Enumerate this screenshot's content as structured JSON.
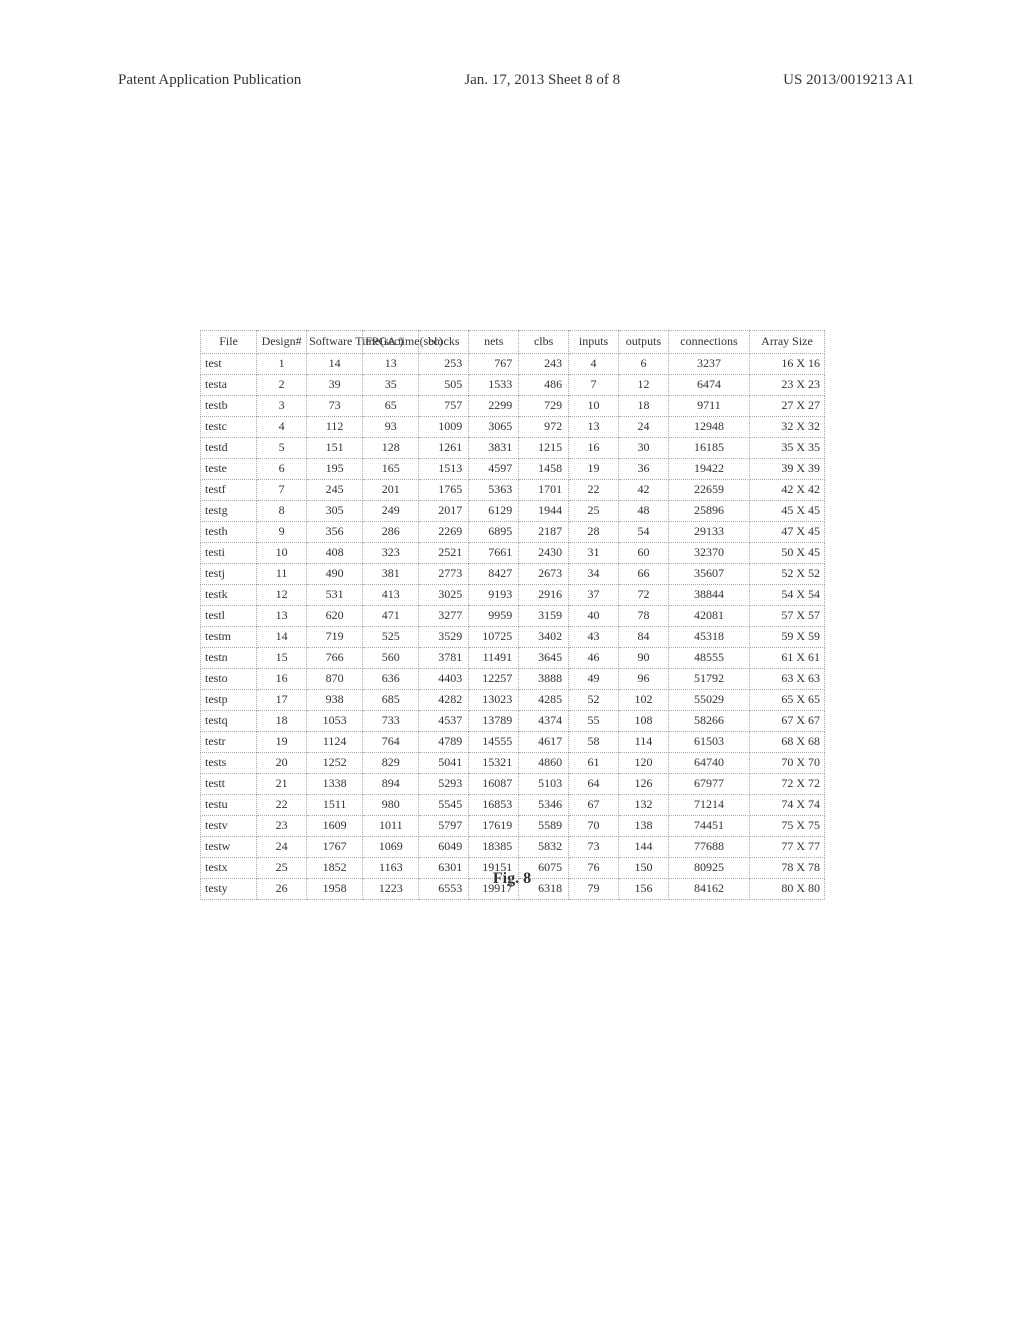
{
  "header": {
    "left": "Patent Application Publication",
    "center": "Jan. 17, 2013  Sheet 8 of 8",
    "right": "US 2013/0019213 A1"
  },
  "table": {
    "columns": [
      "File",
      "Design#",
      "Software Time(sec)",
      "FPGA time(sec)",
      "blocks",
      "nets",
      "clbs",
      "inputs",
      "outputs",
      "connections",
      "Array Size"
    ],
    "rows": [
      {
        "file": "test",
        "design": "1",
        "sw": "14",
        "fpga": "13",
        "blocks": "253",
        "nets": "767",
        "clbs": "243",
        "inputs": "4",
        "outputs": "6",
        "conn": "3237",
        "array": "16 X 16"
      },
      {
        "file": "testa",
        "design": "2",
        "sw": "39",
        "fpga": "35",
        "blocks": "505",
        "nets": "1533",
        "clbs": "486",
        "inputs": "7",
        "outputs": "12",
        "conn": "6474",
        "array": "23 X 23"
      },
      {
        "file": "testb",
        "design": "3",
        "sw": "73",
        "fpga": "65",
        "blocks": "757",
        "nets": "2299",
        "clbs": "729",
        "inputs": "10",
        "outputs": "18",
        "conn": "9711",
        "array": "27 X 27"
      },
      {
        "file": "testc",
        "design": "4",
        "sw": "112",
        "fpga": "93",
        "blocks": "1009",
        "nets": "3065",
        "clbs": "972",
        "inputs": "13",
        "outputs": "24",
        "conn": "12948",
        "array": "32 X 32"
      },
      {
        "file": "testd",
        "design": "5",
        "sw": "151",
        "fpga": "128",
        "blocks": "1261",
        "nets": "3831",
        "clbs": "1215",
        "inputs": "16",
        "outputs": "30",
        "conn": "16185",
        "array": "35 X 35"
      },
      {
        "file": "teste",
        "design": "6",
        "sw": "195",
        "fpga": "165",
        "blocks": "1513",
        "nets": "4597",
        "clbs": "1458",
        "inputs": "19",
        "outputs": "36",
        "conn": "19422",
        "array": "39 X 39"
      },
      {
        "file": "testf",
        "design": "7",
        "sw": "245",
        "fpga": "201",
        "blocks": "1765",
        "nets": "5363",
        "clbs": "1701",
        "inputs": "22",
        "outputs": "42",
        "conn": "22659",
        "array": "42 X 42"
      },
      {
        "file": "testg",
        "design": "8",
        "sw": "305",
        "fpga": "249",
        "blocks": "2017",
        "nets": "6129",
        "clbs": "1944",
        "inputs": "25",
        "outputs": "48",
        "conn": "25896",
        "array": "45 X 45"
      },
      {
        "file": "testh",
        "design": "9",
        "sw": "356",
        "fpga": "286",
        "blocks": "2269",
        "nets": "6895",
        "clbs": "2187",
        "inputs": "28",
        "outputs": "54",
        "conn": "29133",
        "array": "47 X 45"
      },
      {
        "file": "testi",
        "design": "10",
        "sw": "408",
        "fpga": "323",
        "blocks": "2521",
        "nets": "7661",
        "clbs": "2430",
        "inputs": "31",
        "outputs": "60",
        "conn": "32370",
        "array": "50 X 45"
      },
      {
        "file": "testj",
        "design": "11",
        "sw": "490",
        "fpga": "381",
        "blocks": "2773",
        "nets": "8427",
        "clbs": "2673",
        "inputs": "34",
        "outputs": "66",
        "conn": "35607",
        "array": "52 X 52"
      },
      {
        "file": "testk",
        "design": "12",
        "sw": "531",
        "fpga": "413",
        "blocks": "3025",
        "nets": "9193",
        "clbs": "2916",
        "inputs": "37",
        "outputs": "72",
        "conn": "38844",
        "array": "54 X 54"
      },
      {
        "file": "testl",
        "design": "13",
        "sw": "620",
        "fpga": "471",
        "blocks": "3277",
        "nets": "9959",
        "clbs": "3159",
        "inputs": "40",
        "outputs": "78",
        "conn": "42081",
        "array": "57 X 57"
      },
      {
        "file": "testm",
        "design": "14",
        "sw": "719",
        "fpga": "525",
        "blocks": "3529",
        "nets": "10725",
        "clbs": "3402",
        "inputs": "43",
        "outputs": "84",
        "conn": "45318",
        "array": "59 X 59"
      },
      {
        "file": "testn",
        "design": "15",
        "sw": "766",
        "fpga": "560",
        "blocks": "3781",
        "nets": "11491",
        "clbs": "3645",
        "inputs": "46",
        "outputs": "90",
        "conn": "48555",
        "array": "61 X 61"
      },
      {
        "file": "testo",
        "design": "16",
        "sw": "870",
        "fpga": "636",
        "blocks": "4403",
        "nets": "12257",
        "clbs": "3888",
        "inputs": "49",
        "outputs": "96",
        "conn": "51792",
        "array": "63 X 63"
      },
      {
        "file": "testp",
        "design": "17",
        "sw": "938",
        "fpga": "685",
        "blocks": "4282",
        "nets": "13023",
        "clbs": "4285",
        "inputs": "52",
        "outputs": "102",
        "conn": "55029",
        "array": "65 X 65"
      },
      {
        "file": "testq",
        "design": "18",
        "sw": "1053",
        "fpga": "733",
        "blocks": "4537",
        "nets": "13789",
        "clbs": "4374",
        "inputs": "55",
        "outputs": "108",
        "conn": "58266",
        "array": "67 X 67"
      },
      {
        "file": "testr",
        "design": "19",
        "sw": "1124",
        "fpga": "764",
        "blocks": "4789",
        "nets": "14555",
        "clbs": "4617",
        "inputs": "58",
        "outputs": "114",
        "conn": "61503",
        "array": "68 X 68"
      },
      {
        "file": "tests",
        "design": "20",
        "sw": "1252",
        "fpga": "829",
        "blocks": "5041",
        "nets": "15321",
        "clbs": "4860",
        "inputs": "61",
        "outputs": "120",
        "conn": "64740",
        "array": "70 X 70"
      },
      {
        "file": "testt",
        "design": "21",
        "sw": "1338",
        "fpga": "894",
        "blocks": "5293",
        "nets": "16087",
        "clbs": "5103",
        "inputs": "64",
        "outputs": "126",
        "conn": "67977",
        "array": "72 X 72"
      },
      {
        "file": "testu",
        "design": "22",
        "sw": "1511",
        "fpga": "980",
        "blocks": "5545",
        "nets": "16853",
        "clbs": "5346",
        "inputs": "67",
        "outputs": "132",
        "conn": "71214",
        "array": "74 X 74"
      },
      {
        "file": "testv",
        "design": "23",
        "sw": "1609",
        "fpga": "1011",
        "blocks": "5797",
        "nets": "17619",
        "clbs": "5589",
        "inputs": "70",
        "outputs": "138",
        "conn": "74451",
        "array": "75 X 75"
      },
      {
        "file": "testw",
        "design": "24",
        "sw": "1767",
        "fpga": "1069",
        "blocks": "6049",
        "nets": "18385",
        "clbs": "5832",
        "inputs": "73",
        "outputs": "144",
        "conn": "77688",
        "array": "77 X 77"
      },
      {
        "file": "testx",
        "design": "25",
        "sw": "1852",
        "fpga": "1163",
        "blocks": "6301",
        "nets": "19151",
        "clbs": "6075",
        "inputs": "76",
        "outputs": "150",
        "conn": "80925",
        "array": "78 X 78"
      },
      {
        "file": "testy",
        "design": "26",
        "sw": "1958",
        "fpga": "1223",
        "blocks": "6553",
        "nets": "19917",
        "clbs": "6318",
        "inputs": "79",
        "outputs": "156",
        "conn": "84162",
        "array": "80 X 80"
      }
    ]
  },
  "figure_caption": "Fig. 8",
  "chart_data": {
    "type": "table",
    "title": "Fig. 8",
    "columns": [
      "File",
      "Design#",
      "Software Time(sec)",
      "FPGA time(sec)",
      "blocks",
      "nets",
      "clbs",
      "inputs",
      "outputs",
      "connections",
      "Array Size"
    ],
    "rows": [
      [
        "test",
        1,
        14,
        13,
        253,
        767,
        243,
        4,
        6,
        3237,
        "16 X 16"
      ],
      [
        "testa",
        2,
        39,
        35,
        505,
        1533,
        486,
        7,
        12,
        6474,
        "23 X 23"
      ],
      [
        "testb",
        3,
        73,
        65,
        757,
        2299,
        729,
        10,
        18,
        9711,
        "27 X 27"
      ],
      [
        "testc",
        4,
        112,
        93,
        1009,
        3065,
        972,
        13,
        24,
        12948,
        "32 X 32"
      ],
      [
        "testd",
        5,
        151,
        128,
        1261,
        3831,
        1215,
        16,
        30,
        16185,
        "35 X 35"
      ],
      [
        "teste",
        6,
        195,
        165,
        1513,
        4597,
        1458,
        19,
        36,
        19422,
        "39 X 39"
      ],
      [
        "testf",
        7,
        245,
        201,
        1765,
        5363,
        1701,
        22,
        42,
        22659,
        "42 X 42"
      ],
      [
        "testg",
        8,
        305,
        249,
        2017,
        6129,
        1944,
        25,
        48,
        25896,
        "45 X 45"
      ],
      [
        "testh",
        9,
        356,
        286,
        2269,
        6895,
        2187,
        28,
        54,
        29133,
        "47 X 45"
      ],
      [
        "testi",
        10,
        408,
        323,
        2521,
        7661,
        2430,
        31,
        60,
        32370,
        "50 X 45"
      ],
      [
        "testj",
        11,
        490,
        381,
        2773,
        8427,
        2673,
        34,
        66,
        35607,
        "52 X 52"
      ],
      [
        "testk",
        12,
        531,
        413,
        3025,
        9193,
        2916,
        37,
        72,
        38844,
        "54 X 54"
      ],
      [
        "testl",
        13,
        620,
        471,
        3277,
        9959,
        3159,
        40,
        78,
        42081,
        "57 X 57"
      ],
      [
        "testm",
        14,
        719,
        525,
        3529,
        10725,
        3402,
        43,
        84,
        45318,
        "59 X 59"
      ],
      [
        "testn",
        15,
        766,
        560,
        3781,
        11491,
        3645,
        46,
        90,
        48555,
        "61 X 61"
      ],
      [
        "testo",
        16,
        870,
        636,
        4403,
        12257,
        3888,
        49,
        96,
        51792,
        "63 X 63"
      ],
      [
        "testp",
        17,
        938,
        685,
        4282,
        13023,
        4285,
        52,
        102,
        55029,
        "65 X 65"
      ],
      [
        "testq",
        18,
        1053,
        733,
        4537,
        13789,
        4374,
        55,
        108,
        58266,
        "67 X 67"
      ],
      [
        "testr",
        19,
        1124,
        764,
        4789,
        14555,
        4617,
        58,
        114,
        61503,
        "68 X 68"
      ],
      [
        "tests",
        20,
        1252,
        829,
        5041,
        15321,
        4860,
        61,
        120,
        64740,
        "70 X 70"
      ],
      [
        "testt",
        21,
        1338,
        894,
        5293,
        16087,
        5103,
        64,
        126,
        67977,
        "72 X 72"
      ],
      [
        "testu",
        22,
        1511,
        980,
        5545,
        16853,
        5346,
        67,
        132,
        71214,
        "74 X 74"
      ],
      [
        "testv",
        23,
        1609,
        1011,
        5797,
        17619,
        5589,
        70,
        138,
        74451,
        "75 X 75"
      ],
      [
        "testw",
        24,
        1767,
        1069,
        6049,
        18385,
        5832,
        73,
        144,
        77688,
        "77 X 77"
      ],
      [
        "testx",
        25,
        1852,
        1163,
        6301,
        19151,
        6075,
        76,
        150,
        80925,
        "78 X 78"
      ],
      [
        "testy",
        26,
        1958,
        1223,
        6553,
        19917,
        6318,
        79,
        156,
        84162,
        "80 X 80"
      ]
    ]
  }
}
